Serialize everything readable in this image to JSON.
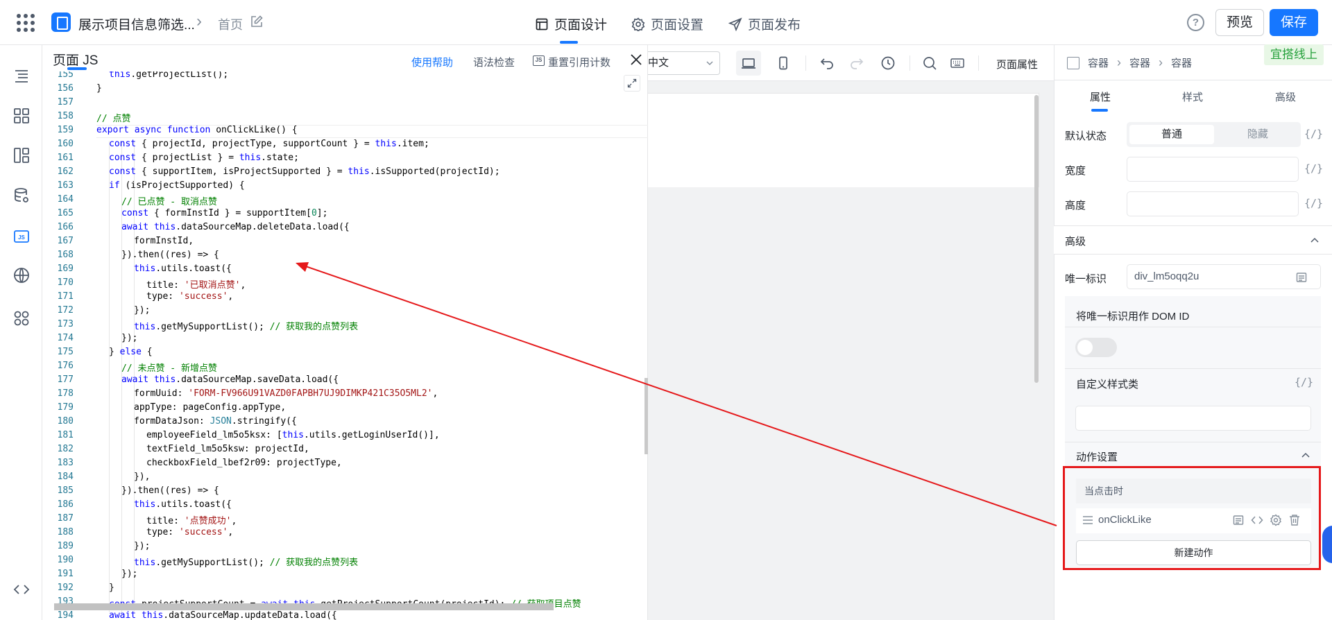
{
  "header": {
    "app_title": "展示项目信息筛选...",
    "breadcrumb_home": "首页",
    "tabs": [
      {
        "label": "页面设计",
        "icon": "layout-icon",
        "active": true
      },
      {
        "label": "页面设置",
        "icon": "gear-icon",
        "active": false
      },
      {
        "label": "页面发布",
        "icon": "send-icon",
        "active": false
      }
    ],
    "preview_label": "预览",
    "save_label": "保存",
    "help_glyph": "?"
  },
  "sidebar": {
    "items": [
      {
        "name": "outline-icon",
        "active": false
      },
      {
        "name": "components-icon",
        "active": false
      },
      {
        "name": "templates-icon",
        "active": false
      },
      {
        "name": "datasource-icon",
        "active": false
      },
      {
        "name": "js-icon",
        "active": true
      },
      {
        "name": "globe-icon",
        "active": false
      },
      {
        "name": "plugins-icon",
        "active": false
      },
      {
        "name": "source-code-icon",
        "active": false
      }
    ]
  },
  "code_panel": {
    "title": "页面 JS",
    "help_link": "使用帮助",
    "lint_link": "语法检查",
    "reset_link": "重置引用计数",
    "js_badge": "JS",
    "lines": [
      {
        "n": "155",
        "i": 1,
        "t": "this.getProjectList();"
      },
      {
        "n": "156",
        "i": 0,
        "t": "}"
      },
      {
        "n": "157",
        "i": 0,
        "t": ""
      },
      {
        "n": "158",
        "i": 0,
        "t": "// 点赞"
      },
      {
        "n": "159",
        "i": 0,
        "t": "export async function onClickLike() {"
      },
      {
        "n": "160",
        "i": 1,
        "t": "const { projectId, projectType, supportCount } = this.item;"
      },
      {
        "n": "161",
        "i": 1,
        "t": "const { projectList } = this.state;"
      },
      {
        "n": "162",
        "i": 1,
        "t": "const { supportItem, isProjectSupported } = this.isSupported(projectId);"
      },
      {
        "n": "163",
        "i": 1,
        "t": "if (isProjectSupported) {"
      },
      {
        "n": "164",
        "i": 2,
        "t": "// 已点赞 - 取消点赞"
      },
      {
        "n": "165",
        "i": 2,
        "t": "const { formInstId } = supportItem[0];"
      },
      {
        "n": "166",
        "i": 2,
        "t": "await this.dataSourceMap.deleteData.load({"
      },
      {
        "n": "167",
        "i": 3,
        "t": "formInstId,"
      },
      {
        "n": "168",
        "i": 2,
        "t": "}).then((res) => {"
      },
      {
        "n": "169",
        "i": 3,
        "t": "this.utils.toast({"
      },
      {
        "n": "170",
        "i": 4,
        "t": "title: '已取消点赞',"
      },
      {
        "n": "171",
        "i": 4,
        "t": "type: 'success',"
      },
      {
        "n": "172",
        "i": 3,
        "t": "});"
      },
      {
        "n": "173",
        "i": 3,
        "t": "this.getMySupportList(); // 获取我的点赞列表"
      },
      {
        "n": "174",
        "i": 2,
        "t": "});"
      },
      {
        "n": "175",
        "i": 1,
        "t": "} else {"
      },
      {
        "n": "176",
        "i": 2,
        "t": "// 未点赞 - 新增点赞"
      },
      {
        "n": "177",
        "i": 2,
        "t": "await this.dataSourceMap.saveData.load({"
      },
      {
        "n": "178",
        "i": 3,
        "t": "formUuid: 'FORM-FV966U91VAZD0FAPBH7UJ9DIMKP421C35O5ML2',"
      },
      {
        "n": "179",
        "i": 3,
        "t": "appType: pageConfig.appType,"
      },
      {
        "n": "180",
        "i": 3,
        "t": "formDataJson: JSON.stringify({"
      },
      {
        "n": "181",
        "i": 4,
        "t": "employeeField_lm5o5ksx: [this.utils.getLoginUserId()],"
      },
      {
        "n": "182",
        "i": 4,
        "t": "textField_lm5o5ksw: projectId,"
      },
      {
        "n": "183",
        "i": 4,
        "t": "checkboxField_lbef2r09: projectType,"
      },
      {
        "n": "184",
        "i": 3,
        "t": "}),"
      },
      {
        "n": "185",
        "i": 2,
        "t": "}).then((res) => {"
      },
      {
        "n": "186",
        "i": 3,
        "t": "this.utils.toast({"
      },
      {
        "n": "187",
        "i": 4,
        "t": "title: '点赞成功',"
      },
      {
        "n": "188",
        "i": 4,
        "t": "type: 'success',"
      },
      {
        "n": "189",
        "i": 3,
        "t": "});"
      },
      {
        "n": "190",
        "i": 3,
        "t": "this.getMySupportList(); // 获取我的点赞列表"
      },
      {
        "n": "191",
        "i": 2,
        "t": "});"
      },
      {
        "n": "192",
        "i": 1,
        "t": "}"
      },
      {
        "n": "193",
        "i": 1,
        "t": "const projectSupportCount = await this.getProjectSupportCount(projectId); // 获取项目点赞"
      },
      {
        "n": "194",
        "i": 1,
        "t": "await this.dataSourceMap.updateData.load({"
      }
    ]
  },
  "canvas": {
    "language_value": "简体中文",
    "page_props_label": "页面属性",
    "toolbar_icons": [
      "desktop-icon",
      "mobile-icon",
      "undo-icon",
      "redo-icon",
      "history-icon",
      "search-icon",
      "keyboard-icon"
    ]
  },
  "right_panel": {
    "breadcrumb": [
      "容器",
      "容器",
      "容器"
    ],
    "online_badge": "宜搭线上",
    "tabs": [
      "属性",
      "样式",
      "高级"
    ],
    "default_state_label": "默认状态",
    "state_normal": "普通",
    "state_hidden": "隐藏",
    "fx_glyph": "{/}",
    "width_label": "宽度",
    "height_label": "高度",
    "advanced_title": "高级",
    "unique_id_label": "唯一标识",
    "unique_id_value": "div_lm5oqq2u",
    "use_as_dom_id_label": "将唯一标识用作 DOM ID",
    "custom_class_label": "自定义样式类",
    "action_settings_title": "动作设置",
    "on_click_label": "当点击时",
    "action_name": "onClickLike",
    "new_action_label": "新建动作"
  },
  "colors": {
    "accent": "#1677ff",
    "annotation_red": "#e5191b",
    "online_green": "#23a03a"
  }
}
